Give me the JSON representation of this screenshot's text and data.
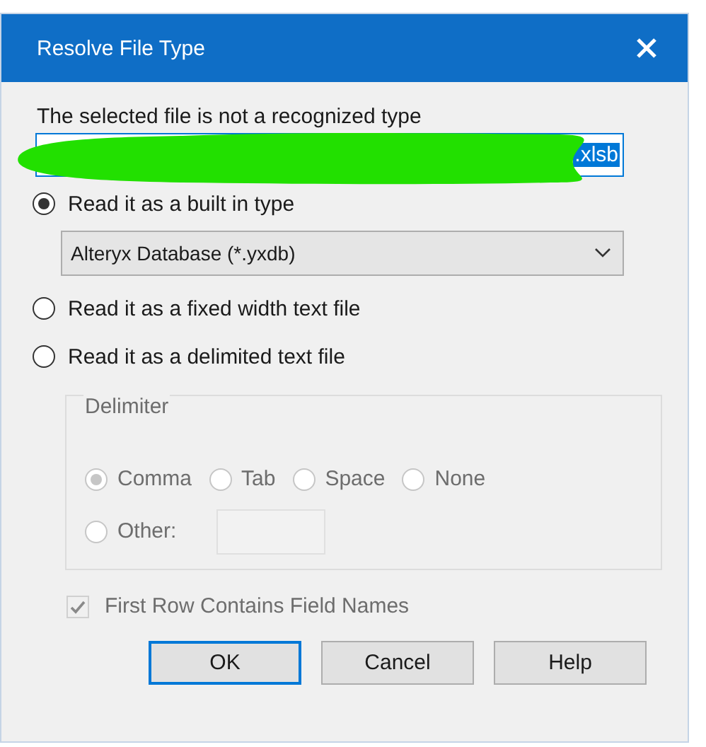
{
  "window": {
    "title": "Resolve File Type"
  },
  "message": "The selected file is not a recognized type",
  "file_field": {
    "value": ".xlsb",
    "text_selected": true
  },
  "read_options": [
    {
      "label": "Read it as a built in type",
      "selected": true,
      "dropdown": {
        "value": "Alteryx Database (*.yxdb)"
      }
    },
    {
      "label": "Read it as a fixed width text file",
      "selected": false
    },
    {
      "label": "Read it as a delimited text file",
      "selected": false
    }
  ],
  "delimiter": {
    "title": "Delimiter",
    "disabled": true,
    "options": [
      {
        "label": "Comma",
        "selected": true,
        "kind": "radio"
      },
      {
        "label": "Tab",
        "selected": false,
        "kind": "radio"
      },
      {
        "label": "Space",
        "selected": false,
        "kind": "radio"
      },
      {
        "label": "None",
        "selected": false,
        "kind": "radio"
      },
      {
        "label": "Other:",
        "selected": false,
        "kind": "other"
      }
    ]
  },
  "first_row_header": {
    "label": "First Row Contains Field Names",
    "checked": true,
    "disabled": true
  },
  "buttons": [
    {
      "label": "OK",
      "default": true
    },
    {
      "label": "Cancel",
      "default": false
    },
    {
      "label": "Help",
      "default": false
    }
  ]
}
